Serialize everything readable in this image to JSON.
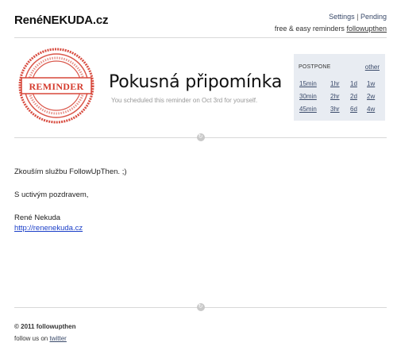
{
  "header": {
    "brand": "RenéNEKUDA.cz",
    "settings_label": "Settings",
    "separator": "|",
    "pending_label": "Pending",
    "tagline": "free & easy reminders",
    "tagline_link": "followupthen"
  },
  "stamp": {
    "text": "REMINDER",
    "color": "#d43a2c"
  },
  "reminder": {
    "title": "Pokusná připomínka",
    "subtitle": "You scheduled this reminder on Oct 3rd for yourself."
  },
  "postpone": {
    "heading": "POSTPONE",
    "other_label": "other",
    "rows": [
      [
        "15min",
        "1hr",
        "1d",
        "1w"
      ],
      [
        "30min",
        "2hr",
        "2d",
        "2w"
      ],
      [
        "45min",
        "3hr",
        "6d",
        "4w"
      ]
    ]
  },
  "divider": {
    "icon": "arrow-circle-icon",
    "glyph": "↻"
  },
  "message": {
    "line1": "Zkouším službu FollowUpThen. ;)",
    "line2": "S uctivým pozdravem,",
    "signature_name": "René Nekuda",
    "signature_link": "http://renenekuda.cz"
  },
  "footer": {
    "copyright": "© 2011 followupthen",
    "follow_prefix": "follow us on",
    "twitter_label": "twitter"
  },
  "colors": {
    "accent": "#3a4a6a",
    "postpone_bg": "#e8ecf2",
    "link": "#1a3ec8"
  }
}
